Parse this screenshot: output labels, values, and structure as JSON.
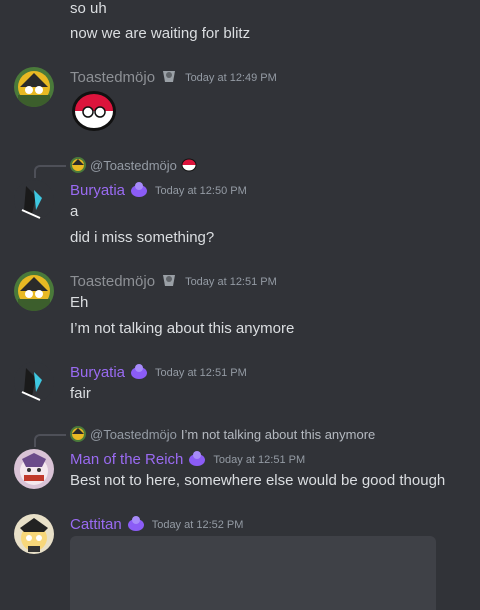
{
  "messages": {
    "m0": {
      "line1": "so uh",
      "line2": "now we are waiting for blitz"
    },
    "m1": {
      "author": "Toastedmöjo",
      "timestamp": "Today at 12:49 PM",
      "sticker": "poland-ball-icon"
    },
    "m2": {
      "reply_name": "@Toastedmöjo",
      "reply_icon": "poland-ball-icon",
      "author": "Buryatia",
      "timestamp": "Today at 12:50 PM",
      "line1": "a",
      "line2": "did i miss something?"
    },
    "m3": {
      "author": "Toastedmöjo",
      "timestamp": "Today at 12:51 PM",
      "line1": "Eh",
      "line2": "I’m not talking about this anymore"
    },
    "m4": {
      "author": "Buryatia",
      "timestamp": "Today at 12:51 PM",
      "line1": "fair"
    },
    "m5": {
      "reply_name": "@Toastedmöjo",
      "reply_text": "I’m not talking about this anymore",
      "author": "Man of the Reich",
      "timestamp": "Today at 12:51 PM",
      "line1": "Best not to here, somewhere else would be good though"
    },
    "m6": {
      "author": "Cattitan",
      "timestamp": "Today at 12:52 PM"
    }
  },
  "colors": {
    "background": "#313338",
    "text": "#dbdee1",
    "author_gray": "#8d9095",
    "author_purple": "#9a6bf2",
    "timestamp": "#949ba4",
    "embed": "#3f4147"
  }
}
